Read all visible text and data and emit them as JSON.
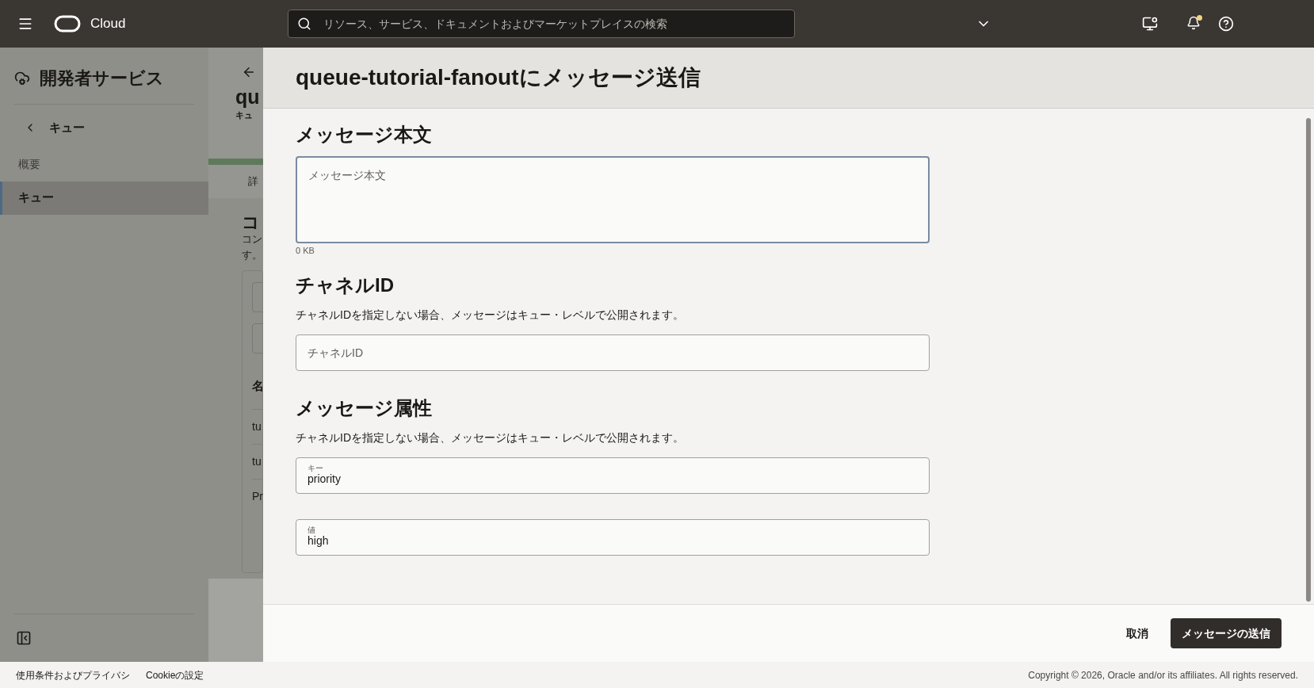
{
  "header": {
    "brand": "Cloud",
    "search": {
      "placeholder": "リソース、サービス、ドキュメントおよびマーケットプレイスの検索"
    }
  },
  "sidebar": {
    "title": "開発者サービス",
    "back": "キュー",
    "items": [
      {
        "label": "概要",
        "selected": false
      },
      {
        "label": "キュー",
        "selected": true
      }
    ]
  },
  "background_page": {
    "heading": "qu",
    "subtitle": "キュ",
    "tab": "詳",
    "section_title": "コ",
    "description": [
      "コン",
      "す。"
    ],
    "column_header": "名",
    "rows": [
      "tu",
      "tu",
      "Pr"
    ]
  },
  "drawer": {
    "title": "queue-tutorial-fanoutにメッセージ送信",
    "message_body": {
      "heading": "メッセージ本文",
      "placeholder": "メッセージ本文",
      "size": "0 KB"
    },
    "channel": {
      "heading": "チャネルID",
      "description": "チャネルIDを指定しない場合、メッセージはキュー・レベルで公開されます。",
      "placeholder": "チャネルID"
    },
    "attributes": {
      "heading": "メッセージ属性",
      "description": "チャネルIDを指定しない場合、メッセージはキュー・レベルで公開されます。",
      "fields": [
        {
          "label": "キー",
          "value": "priority"
        },
        {
          "label": "値",
          "value": "high"
        }
      ]
    },
    "actions": {
      "cancel": "取消",
      "submit": "メッセージの送信"
    }
  },
  "footer": {
    "links": [
      "使用条件およびプライバシ",
      "Cookieの設定"
    ],
    "copyright": "Copyright © 2026, Oracle and/or its affiliates. All rights reserved."
  }
}
